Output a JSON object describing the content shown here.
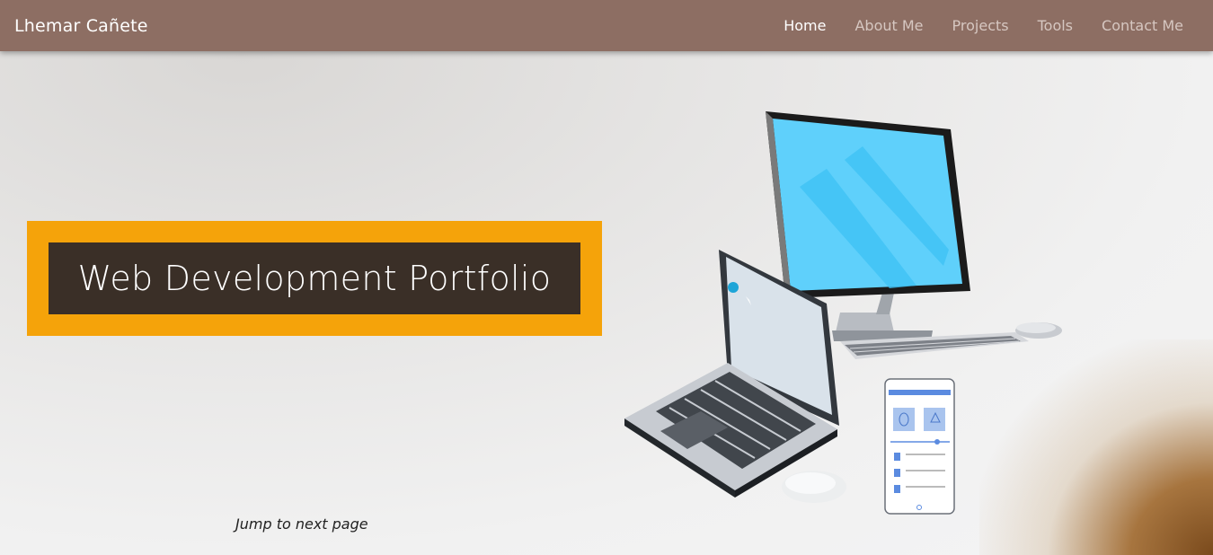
{
  "nav": {
    "brand": "Lhemar Cañete",
    "links": [
      {
        "label": "Home",
        "active": true
      },
      {
        "label": "About Me",
        "active": false
      },
      {
        "label": "Projects",
        "active": false
      },
      {
        "label": "Tools",
        "active": false
      },
      {
        "label": "Contact Me",
        "active": false
      }
    ]
  },
  "hero": {
    "title": "Web Development Portfolio",
    "jump_label": "Jump to next page"
  },
  "colors": {
    "navbar": "#8d6e63",
    "frame": "#f5a30a",
    "title_box": "#3a2f27"
  },
  "illustration": {
    "icons": [
      "desktop-monitor-icon",
      "laptop-icon",
      "smartphone-icon",
      "keyboard-icon",
      "mouse-icon"
    ]
  }
}
